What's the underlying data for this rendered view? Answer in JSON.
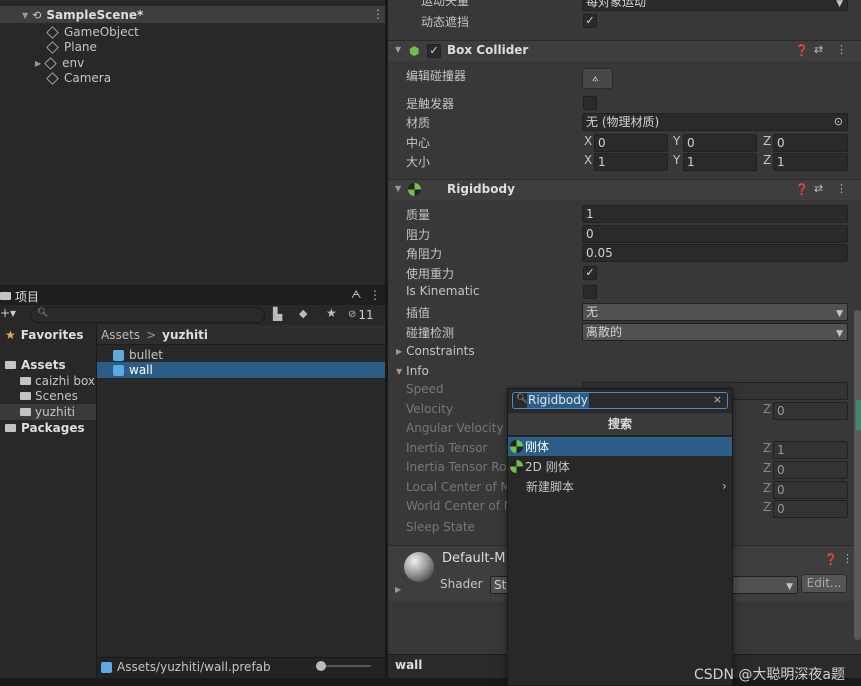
{
  "hierarchy": {
    "scene": "SampleScene*",
    "items": [
      "GameObject",
      "Plane",
      "env",
      "Camera"
    ]
  },
  "project": {
    "tab": "项目",
    "lock_count": "11",
    "favorites": "Favorites",
    "assets_root": "Assets",
    "folders": [
      "caizhi box",
      "Scenes",
      "yuzhiti"
    ],
    "packages": "Packages",
    "breadcrumb_root": "Assets",
    "breadcrumb_current": "yuzhiti",
    "files": [
      "bullet",
      "wall"
    ],
    "footer_path": "Assets/yuzhiti/wall.prefab"
  },
  "inspector": {
    "top_row1_label": "运动矢量",
    "top_row1_value": "每对象运动",
    "top_row2_label": "动态遮挡",
    "box_collider": {
      "title": "Box Collider",
      "edit_label": "编辑碰撞器",
      "trigger_label": "是触发器",
      "material_label": "材质",
      "material_value": "无 (物理材质)",
      "center_label": "中心",
      "center": {
        "x": "0",
        "y": "0",
        "z": "0"
      },
      "size_label": "大小",
      "size": {
        "x": "1",
        "y": "1",
        "z": "1"
      }
    },
    "rigidbody": {
      "title": "Rigidbody",
      "mass_label": "质量",
      "mass": "1",
      "drag_label": "阻力",
      "drag": "0",
      "angular_drag_label": "角阻力",
      "angular_drag": "0.05",
      "gravity_label": "使用重力",
      "kinematic_label": "Is Kinematic",
      "interpolate_label": "插值",
      "interpolate_value": "无",
      "collision_label": "碰撞检测",
      "collision_value": "离散的",
      "constraints_label": "Constraints",
      "info_label": "Info",
      "info_items": [
        "Speed",
        "Velocity",
        "Angular Velocity",
        "Inertia Tensor",
        "Inertia Tensor Ro",
        "Local Center of M",
        "World Center of M",
        "Sleep State"
      ],
      "z_values": [
        "0",
        "1",
        "0",
        "0",
        "0"
      ]
    },
    "material": {
      "name": "Default-M",
      "shader_label": "Shader",
      "shader_value": "St",
      "edit_button": "Edit..."
    },
    "footer_label": "wall"
  },
  "popup": {
    "search_text": "Rigidbody",
    "header": "搜索",
    "items": [
      "刚体",
      "2D 刚体",
      "新建脚本"
    ]
  },
  "watermark": "CSDN @大聪明深夜a题",
  "colors": {
    "accent_blue": "#2c5d87",
    "rigidbody_icon": "#6cc24a",
    "cube_blue": "#5ea9e0"
  }
}
